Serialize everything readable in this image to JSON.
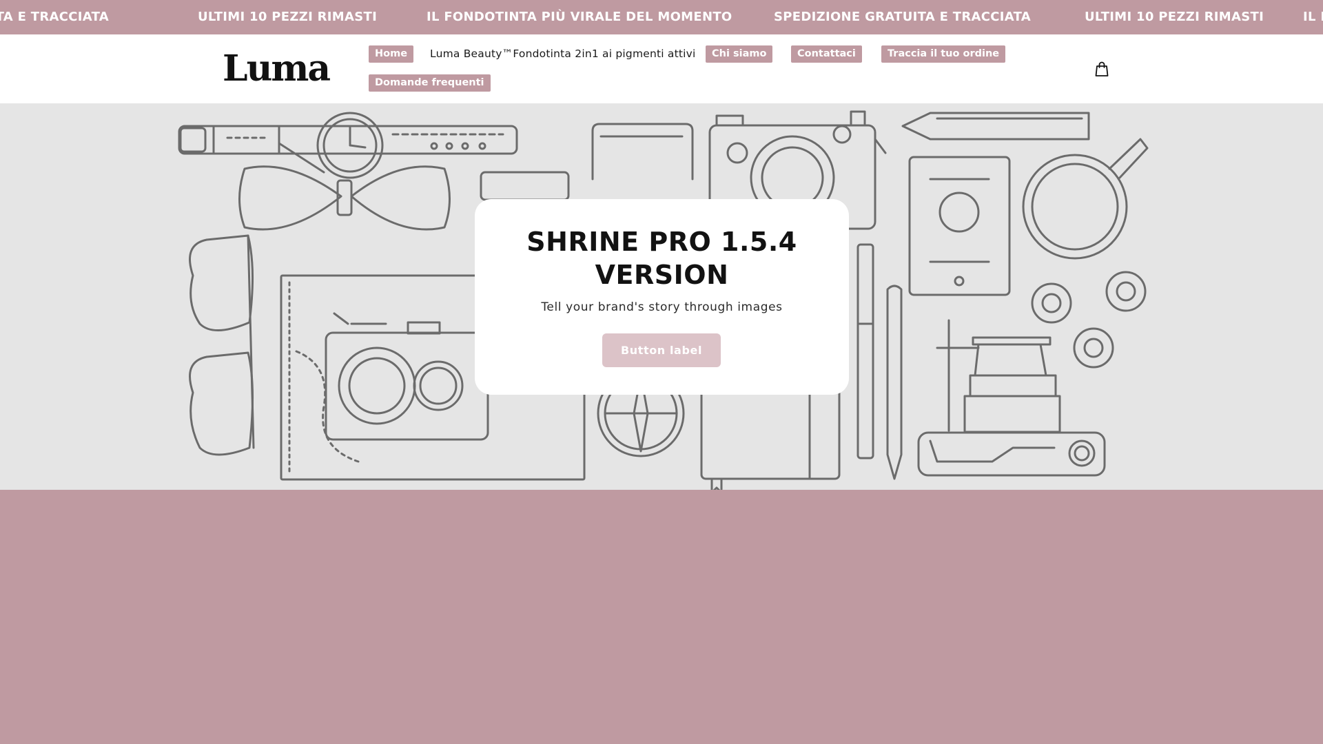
{
  "announcement": {
    "messages": [
      "SPEDIZIONE GRATUITA E TRACCIATA",
      "ULTIMI 10 PEZZI RIMASTI",
      "IL FONDOTINTA PIÙ VIRALE DEL MOMENTO",
      "SPEDIZIONE GRATUITA E TRACCIATA",
      "ULTIMI 10 PEZZI RIMASTI",
      "IL FONDOTINTA PIÙ VIRALE DEL MOMENTO"
    ]
  },
  "header": {
    "logo": "Luma",
    "nav": [
      {
        "label": "Home"
      },
      {
        "label": "Luma Beauty™Fondotinta 2in1 ai pigmenti attivi"
      },
      {
        "label": "Chi siamo"
      },
      {
        "label": "Contattaci"
      },
      {
        "label": "Traccia il tuo ordine"
      },
      {
        "label": "Domande frequenti"
      }
    ],
    "cart_icon": "shopping-bag-icon"
  },
  "hero": {
    "title": "SHRINE PRO 1.5.4 VERSION",
    "subtitle": "Tell your brand's story through images",
    "button_label": "Button label"
  },
  "colors": {
    "accent": "#bf9aa1",
    "button": "#dcc3c8",
    "hero_bg": "#e5e5e5",
    "header_bg": "#ffffff",
    "text": "#121212"
  }
}
